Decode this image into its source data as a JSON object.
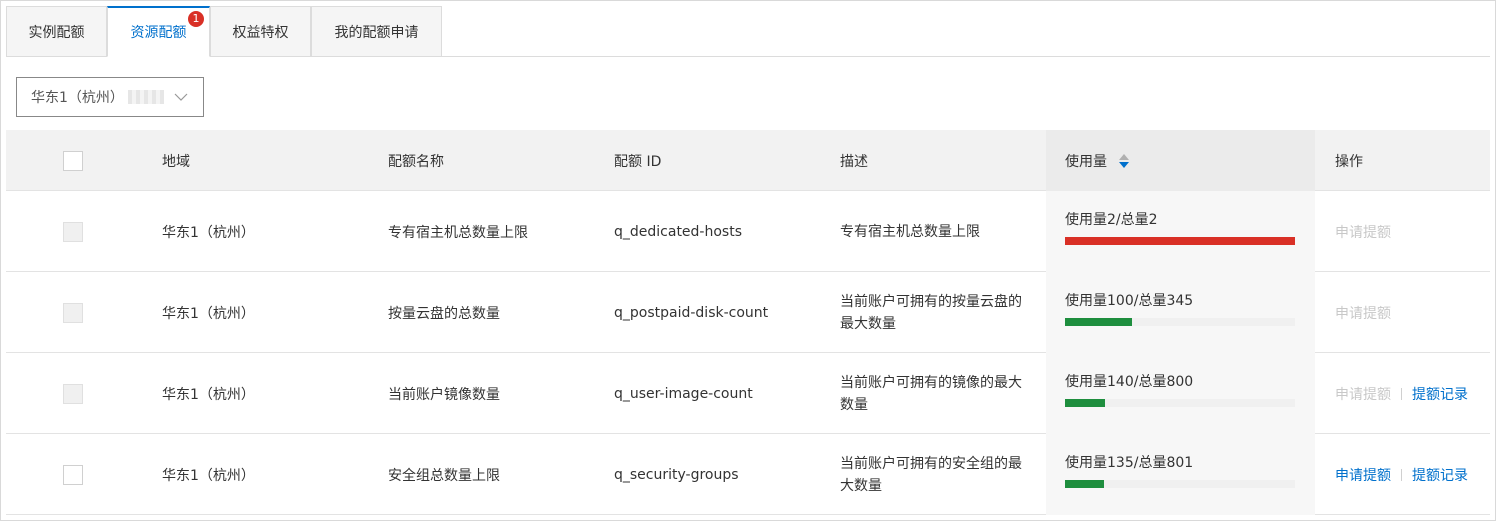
{
  "tabs": [
    {
      "label": "实例配额",
      "active": false
    },
    {
      "label": "资源配额",
      "active": true,
      "badge": "1"
    },
    {
      "label": "权益特权",
      "active": false
    },
    {
      "label": "我的配额申请",
      "active": false
    }
  ],
  "region_select": {
    "value": "华东1（杭州）"
  },
  "table": {
    "headers": {
      "region": "地域",
      "quota_name": "配额名称",
      "quota_id": "配额 ID",
      "description": "描述",
      "usage": "使用量",
      "actions": "操作"
    },
    "rows": [
      {
        "region": "华东1（杭州）",
        "quota_name": "专有宿主机总数量上限",
        "quota_id": "q_dedicated-hosts",
        "description": "专有宿主机总数量上限",
        "usage_text": "使用量2/总量2",
        "usage_ratio": 1.0,
        "bar_color": "#d93026",
        "checkbox_disabled": true,
        "apply_label": "申请提额",
        "apply_enabled": false,
        "record_label": ""
      },
      {
        "region": "华东1（杭州）",
        "quota_name": "按量云盘的总数量",
        "quota_id": "q_postpaid-disk-count",
        "description": "当前账户可拥有的按量云盘的最大数量",
        "usage_text": "使用量100/总量345",
        "usage_ratio": 0.29,
        "bar_color": "#1e8e3e",
        "checkbox_disabled": true,
        "apply_label": "申请提额",
        "apply_enabled": false,
        "record_label": ""
      },
      {
        "region": "华东1（杭州）",
        "quota_name": "当前账户镜像数量",
        "quota_id": "q_user-image-count",
        "description": "当前账户可拥有的镜像的最大数量",
        "usage_text": "使用量140/总量800",
        "usage_ratio": 0.175,
        "bar_color": "#1e8e3e",
        "checkbox_disabled": true,
        "apply_label": "申请提额",
        "apply_enabled": false,
        "record_label": "提额记录"
      },
      {
        "region": "华东1（杭州）",
        "quota_name": "安全组总数量上限",
        "quota_id": "q_security-groups",
        "description": "当前账户可拥有的安全组的最大数量",
        "usage_text": "使用量135/总量801",
        "usage_ratio": 0.169,
        "bar_color": "#1e8e3e",
        "checkbox_disabled": false,
        "apply_label": "申请提额",
        "apply_enabled": true,
        "record_label": "提额记录"
      }
    ]
  }
}
